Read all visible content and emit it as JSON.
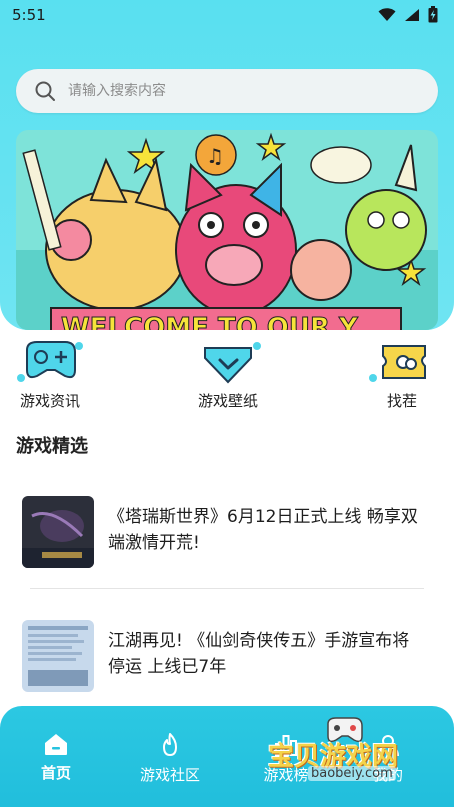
{
  "status": {
    "time": "5:51",
    "wifi_icon": "wifi-icon",
    "signal_icon": "signal-icon",
    "battery_icon": "battery-charging-icon"
  },
  "search": {
    "placeholder": "请输入搜索内容",
    "icon": "search-icon"
  },
  "banner": {
    "text": "WELCOME TO OUR Y"
  },
  "shortcuts": [
    {
      "label": "游戏资讯",
      "icon": "gamepad-icon"
    },
    {
      "label": "游戏壁纸",
      "icon": "diamond-check-icon"
    },
    {
      "label": "找茬",
      "icon": "ticket-icon"
    }
  ],
  "section": {
    "title": "游戏精选"
  },
  "news": [
    {
      "title": "《塔瑞斯世界》6月12日正式上线 畅享双端激情开荒!"
    },
    {
      "title": "江湖再见! 《仙剑奇侠传五》手游宣布将停运 上线已7年"
    }
  ],
  "bottom_nav": [
    {
      "label": "首页",
      "icon": "home-icon",
      "active": true
    },
    {
      "label": "游戏社区",
      "icon": "flame-icon",
      "active": false
    },
    {
      "label": "游戏榜",
      "icon": "ranking-icon",
      "active": false
    },
    {
      "label": "我的",
      "icon": "profile-icon",
      "active": false
    }
  ],
  "watermark": {
    "title": "宝贝游戏网",
    "url": "baobeiy.com"
  },
  "colors": {
    "accent": "#59e0f0",
    "nav_bg": "#26c3df",
    "icon_cyan": "#4fd6ea"
  }
}
